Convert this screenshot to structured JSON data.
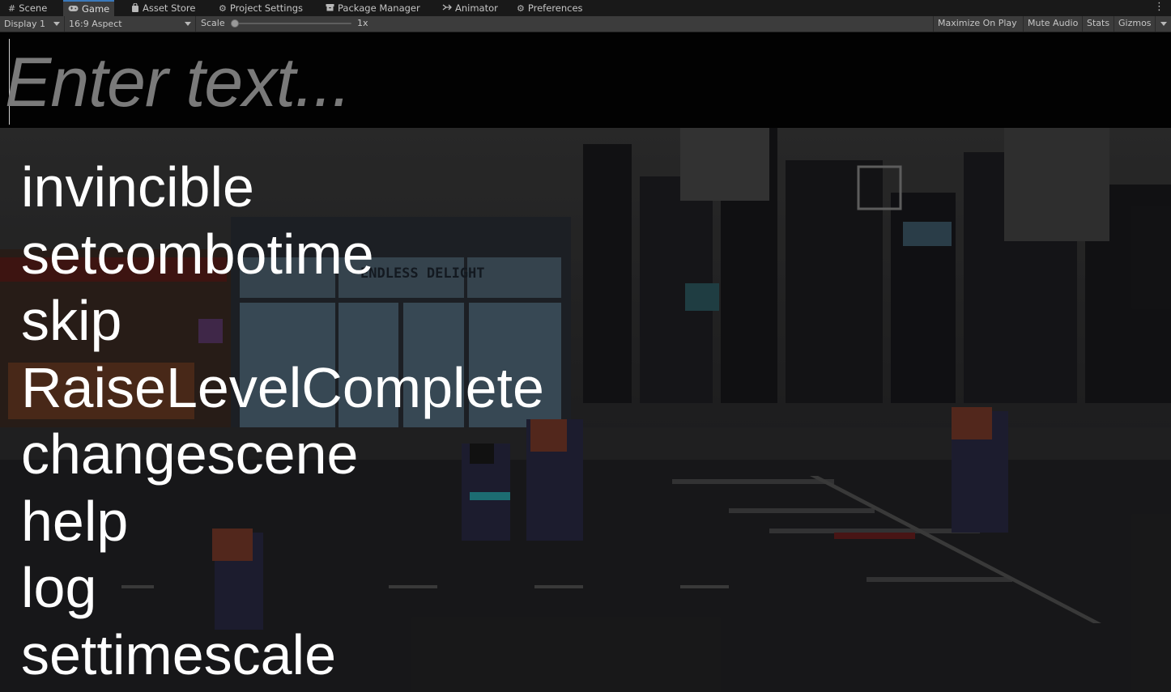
{
  "tabs": [
    {
      "label": "Scene",
      "icon": "grid-icon",
      "active": false
    },
    {
      "label": "Game",
      "icon": "gamepad-icon",
      "active": true
    },
    {
      "label": "Asset Store",
      "icon": "bag-icon",
      "active": false
    },
    {
      "label": "Project Settings",
      "icon": "gear-icon",
      "active": false
    },
    {
      "label": "Package Manager",
      "icon": "box-icon",
      "active": false
    },
    {
      "label": "Animator",
      "icon": "animator-icon",
      "active": false
    },
    {
      "label": "Preferences",
      "icon": "gear-icon",
      "active": false
    }
  ],
  "toolbar": {
    "display": "Display 1",
    "aspect": "16:9 Aspect",
    "scale_label": "Scale",
    "scale_value": "1x",
    "scale_slider_level": 0,
    "maximize_on_play": "Maximize On Play",
    "mute_audio": "Mute Audio",
    "stats": "Stats",
    "gizmos": "Gizmos"
  },
  "console": {
    "placeholder": "Enter text...",
    "suggestions": [
      "invincible",
      "setcombotime",
      "skip",
      "RaiseLevelComplete",
      "changescene",
      "help",
      "log",
      "settimescale"
    ]
  },
  "scene": {
    "storefront_sign": "ENDLESS DELIGHT"
  },
  "colors": {
    "editor_bg": "#191919",
    "toolbar_bg": "#3c3c3c",
    "active_tab_accent": "#3a79bb",
    "placeholder": "#7a7a7a",
    "suggestion_text": "#ffffff"
  }
}
